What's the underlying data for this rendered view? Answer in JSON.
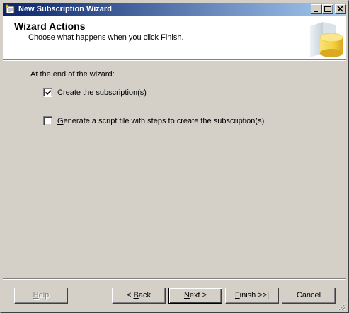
{
  "window": {
    "title": "New Subscription Wizard"
  },
  "header": {
    "title": "Wizard Actions",
    "subtitle": "Choose what happens when you click Finish."
  },
  "main": {
    "section_label": "At the end of the wizard:",
    "options": [
      {
        "label_pre": "",
        "label_key": "C",
        "label_post": "reate the subscription(s)",
        "checked": true
      },
      {
        "label_pre": "",
        "label_key": "G",
        "label_post": "enerate a script file with steps to create the subscription(s)",
        "checked": false
      }
    ]
  },
  "footer": {
    "help": {
      "key": "H",
      "rest": "elp",
      "enabled": false
    },
    "back": {
      "pre": "< ",
      "key": "B",
      "rest": "ack",
      "enabled": true
    },
    "next": {
      "key": "N",
      "rest": "ext >",
      "enabled": true,
      "default": true
    },
    "finish": {
      "key": "F",
      "rest": "inish >>|",
      "enabled": true
    },
    "cancel": {
      "label": "Cancel",
      "enabled": true
    }
  },
  "icons": {
    "app": "wizard-app-icon",
    "header_art": "database-cylinder-icon",
    "check": "checkmark-icon"
  },
  "colors": {
    "title_bar_start": "#0a246a",
    "title_bar_end": "#a6caf0",
    "face": "#d4d0c8",
    "header_art_accent": "#f5d03c"
  }
}
